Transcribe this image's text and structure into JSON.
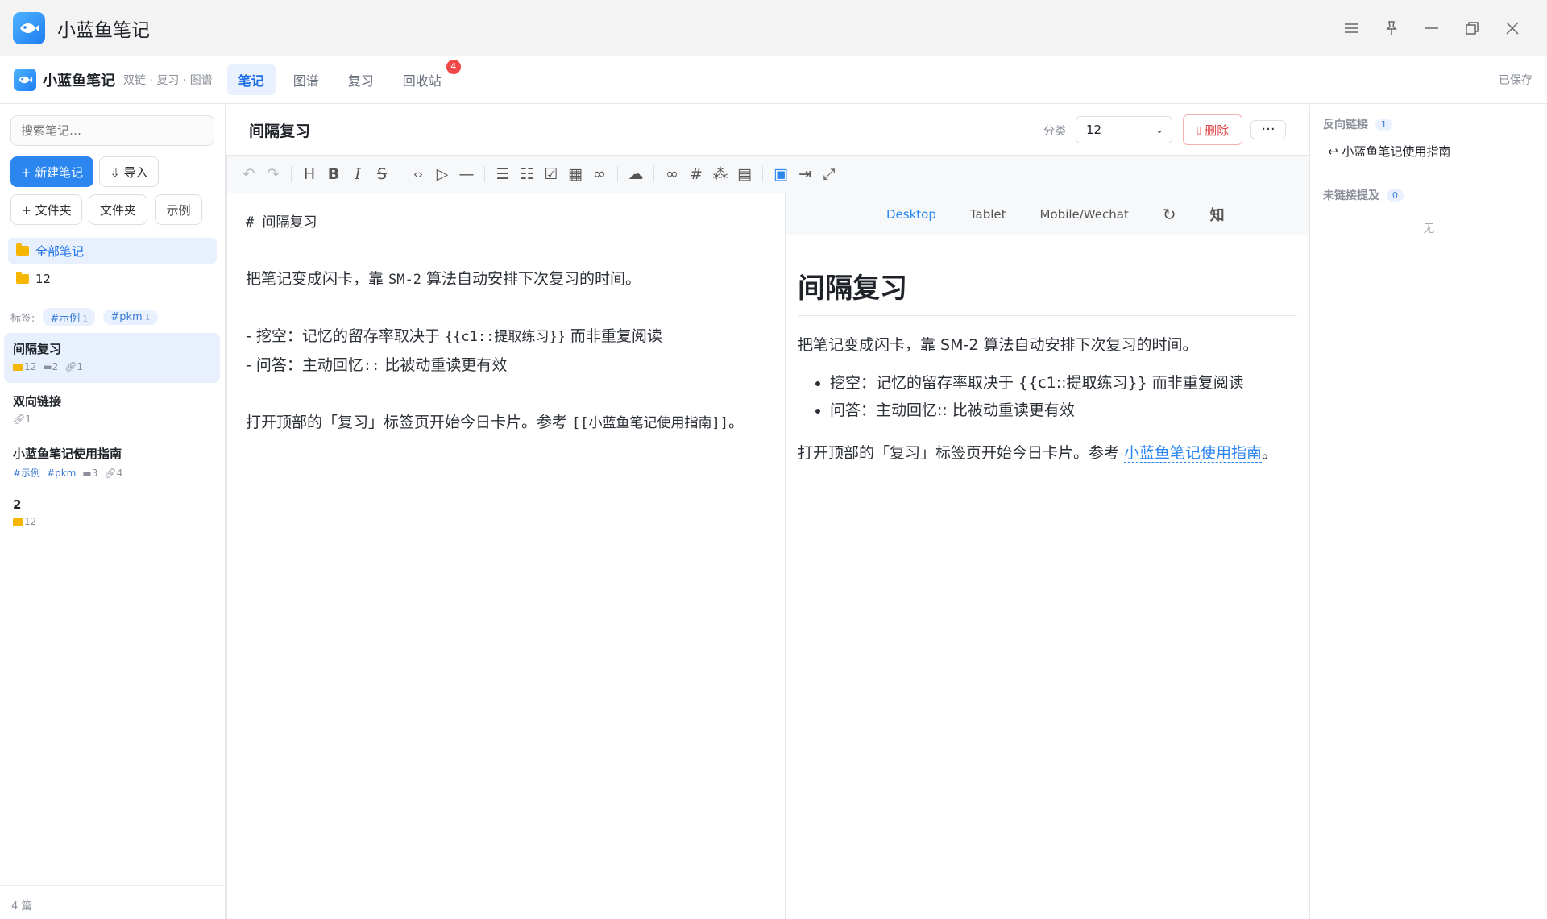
{
  "window": {
    "title": "小蓝鱼笔记"
  },
  "header": {
    "brand": "小蓝鱼笔记",
    "subtitle": "双链 · 复习 · 图谱",
    "tabs": [
      {
        "label": "笔记",
        "active": true
      },
      {
        "label": "图谱"
      },
      {
        "label": "复习"
      },
      {
        "label": "回收站",
        "badge": "4"
      }
    ],
    "status": "已保存"
  },
  "sidebar": {
    "search_placeholder": "搜索笔记…",
    "new_note": "+ 新建笔记",
    "import": "⇩ 导入",
    "new_folder": "+ 文件夹",
    "folder": "文件夹",
    "example": "示例",
    "folders": [
      {
        "label": "全部笔记",
        "active": true
      },
      {
        "label": "12"
      }
    ],
    "tags_label": "标签:",
    "tags": [
      {
        "name": "#示例",
        "count": "1"
      },
      {
        "name": "#pkm",
        "count": "1"
      }
    ],
    "notes": [
      {
        "title": "间隔复习",
        "folder": "12",
        "blocks": "2",
        "links": "1",
        "active": true
      },
      {
        "title": "双向链接",
        "links": "1"
      },
      {
        "title": "小蓝鱼笔记使用指南",
        "tag1": "#示例",
        "tag2": "#pkm",
        "blocks": "3",
        "links": "4"
      },
      {
        "title": "2",
        "folder": "12"
      }
    ],
    "footer": "4 篇"
  },
  "note": {
    "title": "间隔复习",
    "category_label": "分类",
    "category_value": "12",
    "delete_label": "删除",
    "more_label": "···"
  },
  "editor": {
    "src_heading": "# 间隔复习",
    "src_p1_a": "把笔记变成闪卡，靠 ",
    "src_p1_code": "SM-2",
    "src_p1_b": " 算法自动安排下次复习的时间。",
    "src_li1_a": "- 挖空：记忆的留存率取决于 ",
    "src_li1_code": "{{c1::提取练习}}",
    "src_li1_b": " 而非重复阅读",
    "src_li2_a": "- 问答：主动回忆",
    "src_li2_code": "::",
    "src_li2_b": " 比被动重读更有效",
    "src_p2_a": "打开顶部的「复习」标签页开始今日卡片。参考 ",
    "src_p2_code": "[[小蓝鱼笔记使用指南]]",
    "src_p2_b": "。"
  },
  "preview": {
    "modes": [
      "Desktop",
      "Tablet",
      "Mobile/Wechat"
    ],
    "zhi": "知",
    "h1": "间隔复习",
    "p1": "把笔记变成闪卡，靠 SM-2 算法自动安排下次复习的时间。",
    "li1": "挖空：记忆的留存率取决于 {{c1::提取练习}} 而非重复阅读",
    "li2": "问答：主动回忆:: 比被动重读更有效",
    "p2_a": "打开顶部的「复习」标签页开始今日卡片。参考 ",
    "p2_link": "小蓝鱼笔记使用指南",
    "p2_b": "。"
  },
  "rightpanel": {
    "backlinks_label": "反向链接",
    "backlinks_count": "1",
    "backlink_item": "↩ 小蓝鱼笔记使用指南",
    "unlinked_label": "未链接提及",
    "unlinked_count": "0",
    "unlinked_empty": "无"
  },
  "colors": {
    "accent": "#2b86f0",
    "danger": "#e5484d",
    "folder": "#f5b500"
  }
}
